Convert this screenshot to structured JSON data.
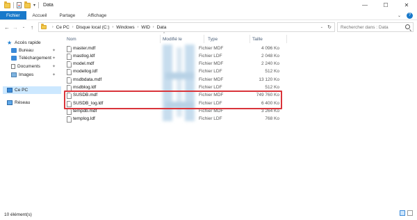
{
  "window": {
    "title": "Data"
  },
  "ribbon": {
    "tabs": [
      "Fichier",
      "Accueil",
      "Partage",
      "Affichage"
    ],
    "help": "?"
  },
  "window_controls": {
    "minimize": "—",
    "maximize": "☐",
    "close": "✕"
  },
  "address": {
    "crumbs": [
      "Ce PC",
      "Disque local (C:)",
      "Windows",
      "WID",
      "Data"
    ],
    "search_placeholder": "Rechercher dans : Data"
  },
  "nav": {
    "items": [
      {
        "label": "Accès rapide",
        "icon": "star-icon"
      },
      {
        "label": "Bureau",
        "icon": "desktop-icon",
        "pinned": true
      },
      {
        "label": "Téléchargement",
        "icon": "download-icon",
        "pinned": true
      },
      {
        "label": "Documents",
        "icon": "documents-icon",
        "pinned": true
      },
      {
        "label": "Images",
        "icon": "images-icon",
        "pinned": true
      },
      {
        "label": "Ce PC",
        "icon": "computer-icon",
        "selected": true
      },
      {
        "label": "Réseau",
        "icon": "network-icon"
      }
    ]
  },
  "columns": {
    "name": "Nom",
    "modified": "Modifié le",
    "type": "Type",
    "size": "Taille"
  },
  "files": [
    {
      "name": "master.mdf",
      "type": "Fichier MDF",
      "size": "4 096 Ko"
    },
    {
      "name": "mastlog.ldf",
      "type": "Fichier LDF",
      "size": "2 048 Ko"
    },
    {
      "name": "model.mdf",
      "type": "Fichier MDF",
      "size": "2 240 Ko"
    },
    {
      "name": "modellog.ldf",
      "type": "Fichier LDF",
      "size": "512 Ko"
    },
    {
      "name": "msdbdata.mdf",
      "type": "Fichier MDF",
      "size": "13 120 Ko"
    },
    {
      "name": "msdblog.ldf",
      "type": "Fichier LDF",
      "size": "512 Ko"
    },
    {
      "name": "SUSDB.mdf",
      "type": "Fichier MDF",
      "size": "749 760 Ko",
      "highlighted": true
    },
    {
      "name": "SUSDB_log.ldf",
      "type": "Fichier LDF",
      "size": "6 400 Ko",
      "highlighted": true
    },
    {
      "name": "tempdb.mdf",
      "type": "Fichier MDF",
      "size": "3 264 Ko"
    },
    {
      "name": "templog.ldf",
      "type": "Fichier LDF",
      "size": "768 Ko"
    }
  ],
  "status": {
    "count": "10 élément(s)"
  },
  "colors": {
    "accent": "#1979ca",
    "highlight": "#d9343a",
    "selection": "#cce8ff"
  }
}
